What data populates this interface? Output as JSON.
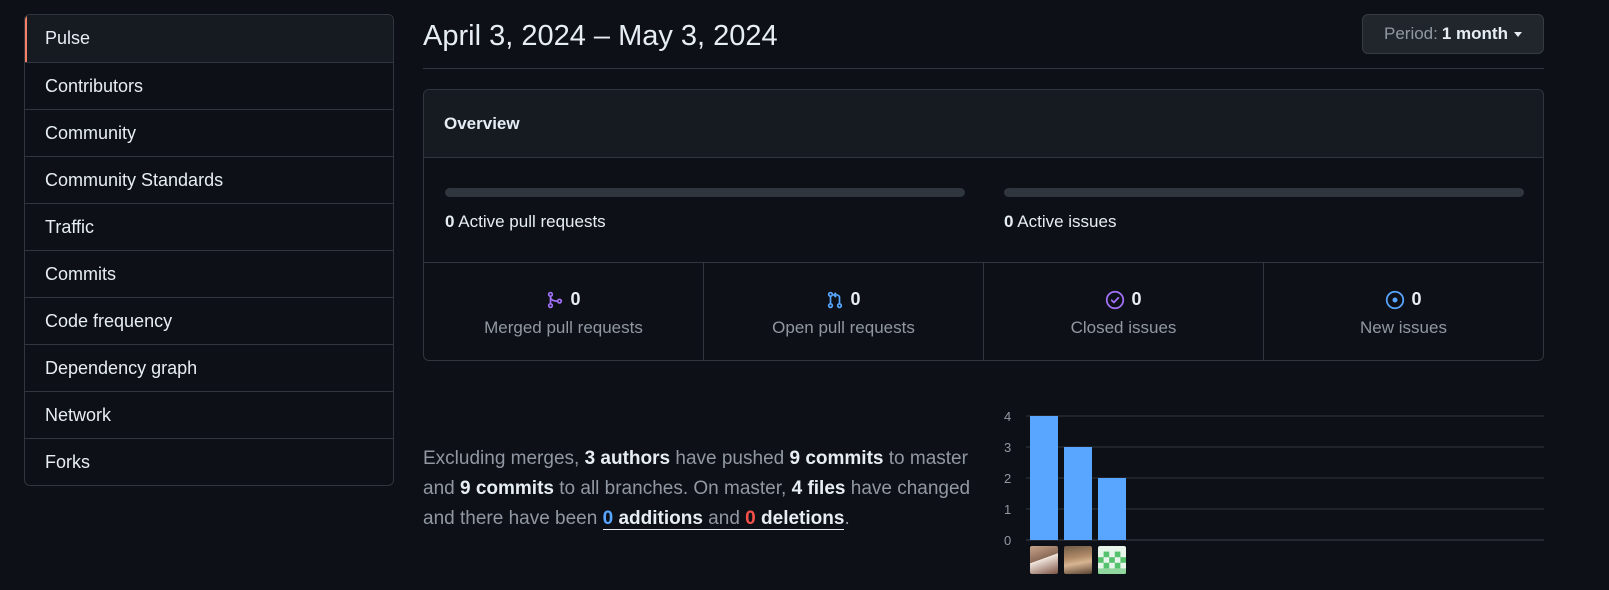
{
  "sidebar": {
    "items": [
      {
        "label": "Pulse"
      },
      {
        "label": "Contributors"
      },
      {
        "label": "Community"
      },
      {
        "label": "Community Standards"
      },
      {
        "label": "Traffic"
      },
      {
        "label": "Commits"
      },
      {
        "label": "Code frequency"
      },
      {
        "label": "Dependency graph"
      },
      {
        "label": "Network"
      },
      {
        "label": "Forks"
      }
    ],
    "active_index": 0
  },
  "header": {
    "date_range": "April 3, 2024 – May 3, 2024",
    "period_prefix": "Period:",
    "period_value": "1 month"
  },
  "overview": {
    "title": "Overview",
    "active_prs_count": "0",
    "active_prs_label": "Active pull requests",
    "active_issues_count": "0",
    "active_issues_label": "Active issues",
    "stats": [
      {
        "icon": "merged-pr-icon",
        "count": "0",
        "label": "Merged pull requests",
        "color": "#a371f7"
      },
      {
        "icon": "open-pr-icon",
        "count": "0",
        "label": "Open pull requests",
        "color": "#58a6ff"
      },
      {
        "icon": "closed-issue-icon",
        "count": "0",
        "label": "Closed issues",
        "color": "#a371f7"
      },
      {
        "icon": "new-issue-icon",
        "count": "0",
        "label": "New issues",
        "color": "#58a6ff"
      }
    ]
  },
  "summary": {
    "t1": "Excluding merges, ",
    "authors": "3 authors",
    "t2": " have pushed ",
    "commits_master": "9 commits",
    "t3": " to master and ",
    "commits_all": "9 commits",
    "t4": " to all branches. On master, ",
    "files": "4 files",
    "t5": " have changed and there have been ",
    "additions_num": "0",
    "additions_word": " additions",
    "t6": " and ",
    "deletions_num": "0",
    "deletions_word": " deletions",
    "t7": "."
  },
  "chart_data": {
    "type": "bar",
    "categories": [
      "author-1",
      "author-2",
      "author-3"
    ],
    "values": [
      4,
      3,
      2
    ],
    "yticks": [
      "4",
      "3",
      "2",
      "1",
      "0"
    ],
    "ylim": [
      0,
      4
    ],
    "bar_color": "#58a6ff",
    "grid": true
  }
}
